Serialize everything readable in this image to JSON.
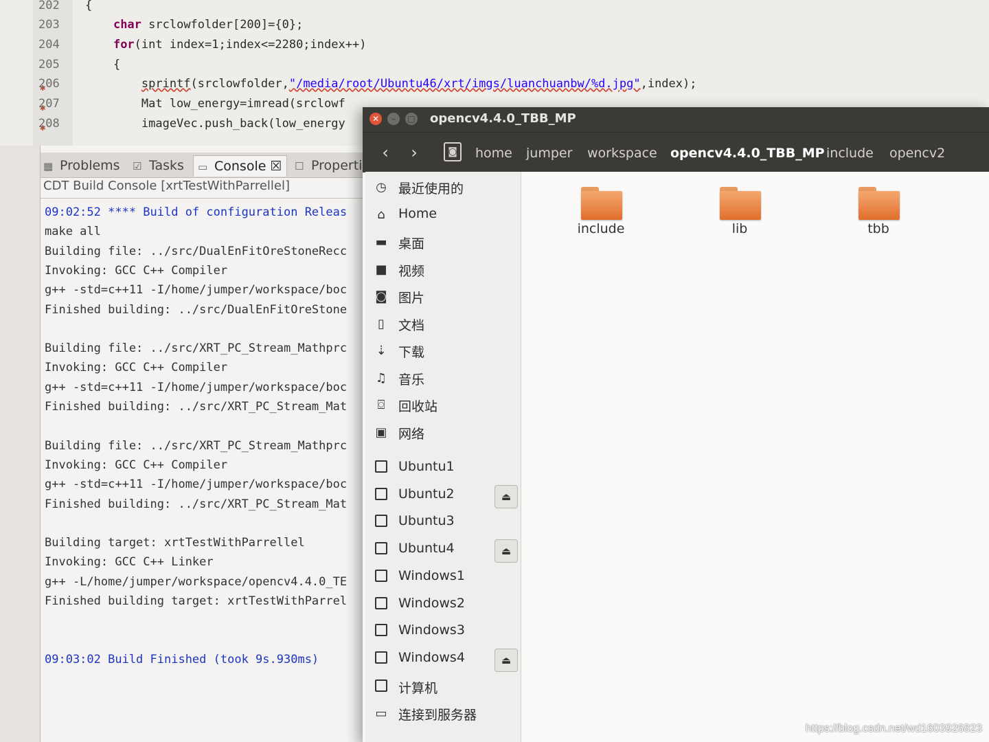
{
  "editor": {
    "lines": [
      {
        "n": "202",
        "code": "{",
        "warn": false
      },
      {
        "n": "203",
        "kw": "char",
        "rest": " srclowfolder[200]={0};",
        "indent": "    ",
        "warn": false
      },
      {
        "n": "204",
        "kw": "for",
        "rest": "(int index=1;index<=2280;index++)",
        "indent": "    ",
        "warn": false
      },
      {
        "n": "205",
        "code": "    {",
        "warn": false
      },
      {
        "n": "206",
        "fn": "sprintf",
        "pre": "(srclowfolder,",
        "str": "\"/media/root/Ubuntu46/xrt/imgs/luanchuanbw/%d.jpg\"",
        "post": ",index);",
        "indent": "        ",
        "warn": true
      },
      {
        "n": "207",
        "code": "        Mat low_energy=imread(srclowf",
        "warn": true
      },
      {
        "n": "208",
        "code": "        imageVec.push_back(low_energy",
        "warn": true
      }
    ]
  },
  "console_view": {
    "tabs": [
      {
        "label": "Problems",
        "icon": "problems-icon"
      },
      {
        "label": "Tasks",
        "icon": "tasks-icon"
      },
      {
        "label": "Console ☒",
        "icon": "console-icon",
        "active": true
      },
      {
        "label": "Properti",
        "icon": "properties-icon"
      }
    ],
    "title": "CDT Build Console [xrtTestWithParrellel]",
    "lines": [
      {
        "text": "09:02:52 **** Build of configuration Releas",
        "blue": true
      },
      {
        "text": "make all"
      },
      {
        "text": "Building file: ../src/DualEnFitOreStoneRecc"
      },
      {
        "text": "Invoking: GCC C++ Compiler"
      },
      {
        "text": "g++ -std=c++11 -I/home/jumper/workspace/boc"
      },
      {
        "text": "Finished building: ../src/DualEnFitOreStone"
      },
      {
        "text": ""
      },
      {
        "text": "Building file: ../src/XRT_PC_Stream_Mathprc"
      },
      {
        "text": "Invoking: GCC C++ Compiler"
      },
      {
        "text": "g++ -std=c++11 -I/home/jumper/workspace/boc"
      },
      {
        "text": "Finished building: ../src/XRT_PC_Stream_Mat"
      },
      {
        "text": ""
      },
      {
        "text": "Building file: ../src/XRT_PC_Stream_Mathprc"
      },
      {
        "text": "Invoking: GCC C++ Compiler"
      },
      {
        "text": "g++ -std=c++11 -I/home/jumper/workspace/boc"
      },
      {
        "text": "Finished building: ../src/XRT_PC_Stream_Mat"
      },
      {
        "text": ""
      },
      {
        "text": "Building target: xrtTestWithParrellel"
      },
      {
        "text": "Invoking: GCC C++ Linker"
      },
      {
        "text": "g++ -L/home/jumper/workspace/opencv4.4.0_TE"
      },
      {
        "text": "Finished building target: xrtTestWithParrel"
      },
      {
        "text": ""
      },
      {
        "text": ""
      },
      {
        "text": "09:03:02 Build Finished (took 9s.930ms)",
        "blue": true
      }
    ]
  },
  "nautilus": {
    "window_title": "opencv4.4.0_TBB_MP",
    "breadcrumbs": [
      "home",
      "jumper",
      "workspace",
      "opencv4.4.0_TBB_MP",
      "include",
      "opencv2"
    ],
    "current_crumb": "opencv4.4.0_TBB_MP",
    "sidebar": [
      {
        "label": "最近使用的",
        "icon": "recent-icon",
        "glyph": "◷"
      },
      {
        "label": "Home",
        "icon": "home-icon",
        "glyph": "⌂"
      },
      {
        "label": "桌面",
        "icon": "desktop-folder-icon",
        "glyph": "▬"
      },
      {
        "label": "视频",
        "icon": "video-icon",
        "glyph": "■"
      },
      {
        "label": "图片",
        "icon": "camera-icon",
        "glyph": "◙"
      },
      {
        "label": "文档",
        "icon": "document-icon",
        "glyph": "▯"
      },
      {
        "label": "下载",
        "icon": "download-icon",
        "glyph": "⇣"
      },
      {
        "label": "音乐",
        "icon": "music-icon",
        "glyph": "♫"
      },
      {
        "label": "回收站",
        "icon": "trash-icon",
        "glyph": "⌼"
      },
      {
        "label": "网络",
        "icon": "network-icon",
        "glyph": "▣"
      },
      {
        "label": "Ubuntu1",
        "icon": "drive-icon",
        "glyph": "drive",
        "eject": false
      },
      {
        "label": "Ubuntu2",
        "icon": "drive-icon",
        "glyph": "drive",
        "eject": true
      },
      {
        "label": "Ubuntu3",
        "icon": "drive-icon",
        "glyph": "drive",
        "eject": false
      },
      {
        "label": "Ubuntu4",
        "icon": "drive-icon",
        "glyph": "drive",
        "eject": true
      },
      {
        "label": "Windows1",
        "icon": "drive-icon",
        "glyph": "drive",
        "eject": false
      },
      {
        "label": "Windows2",
        "icon": "drive-icon",
        "glyph": "drive",
        "eject": false
      },
      {
        "label": "Windows3",
        "icon": "drive-icon",
        "glyph": "drive",
        "eject": false
      },
      {
        "label": "Windows4",
        "icon": "drive-icon",
        "glyph": "drive",
        "eject": true
      },
      {
        "label": "计算机",
        "icon": "computer-icon",
        "glyph": "drive"
      },
      {
        "label": "连接到服务器",
        "icon": "server-icon",
        "glyph": "▭"
      }
    ],
    "folders": [
      {
        "name": "include"
      },
      {
        "name": "lib"
      },
      {
        "name": "tbb"
      }
    ]
  },
  "watermark": "https://blog.csdn.net/wd1603926823",
  "colors": {
    "folder": "#e8803f",
    "titlebar": "#3b3a37",
    "close": "#e0553a",
    "console_blue": "#1c35c4"
  }
}
